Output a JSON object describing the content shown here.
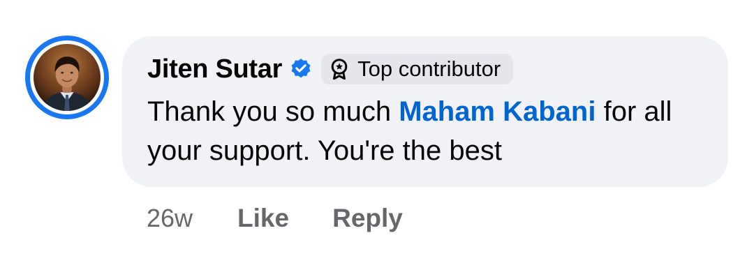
{
  "comment": {
    "author": "Jiten Sutar",
    "verified_icon": "verified-badge-icon",
    "badge": {
      "icon": "top-contributor-icon",
      "label": "Top contributor"
    },
    "text_before_mention": "Thank you so much ",
    "mention": "Maham Kabani",
    "text_after_mention": " for all your support. You're the best",
    "time": "26w",
    "like_label": "Like",
    "reply_label": "Reply"
  },
  "colors": {
    "avatar_ring": "#1877f2",
    "bubble_bg": "#f0f2f5",
    "badge_bg": "#e4e6eb",
    "mention": "#0064d1",
    "secondary_text": "#65676b"
  }
}
